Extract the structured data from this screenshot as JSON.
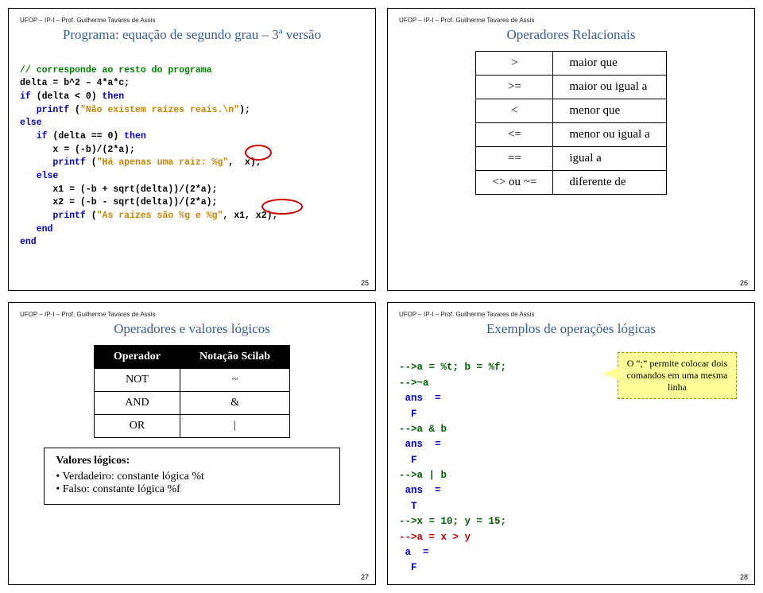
{
  "header": "UFOP – IP-I – Prof. Guilherme Tavares de Assis",
  "pages": [
    "25",
    "26",
    "27",
    "28"
  ],
  "s1": {
    "title": "Programa: equação de segundo grau – 3ª versão",
    "code_comment": "// corresponde ao resto do programa",
    "l2_a": "delta = b^2 – 4*a*c;",
    "l3_if": "if",
    "l3_b": " (delta < 0) ",
    "l3_then": "then",
    "l4_p": "printf",
    "l4_a": " (",
    "l4_s": "\"Não existem raízes reais.\\n\"",
    "l4_b": ");",
    "l5_else": "else",
    "l6_if": "if",
    "l6_b": " (delta == 0) ",
    "l6_then": "then",
    "l7_a": "      x = (-b)/(2*a);",
    "l8_p": "printf",
    "l8_a": " (",
    "l8_s": "\"Há apenas uma raiz: %g\"",
    "l8_b": ",  x);",
    "l9_else": "else",
    "l10": "      x1 = (-b + sqrt(delta))/(2*a);",
    "l11": "      x2 = (-b - sqrt(delta))/(2*a);",
    "l12_p": "printf",
    "l12_a": " (",
    "l12_s": "\"As raizes são %g e %g\"",
    "l12_b": ", x1, x2);",
    "l13_end": "end",
    "l14_end": "end"
  },
  "s2": {
    "title": "Operadores Relacionais",
    "rows": [
      {
        "op": ">",
        "desc": "maior que"
      },
      {
        "op": ">=",
        "desc": "maior ou igual a"
      },
      {
        "op": "<",
        "desc": "menor que"
      },
      {
        "op": "<=",
        "desc": "menor ou igual a"
      },
      {
        "op": "==",
        "desc": "igual a"
      },
      {
        "op": "<> ou ~=",
        "desc": "diferente de"
      }
    ]
  },
  "s3": {
    "title": "Operadores e valores lógicos",
    "hdr_l": "Operador",
    "hdr_r": "Notação Scilab",
    "rows": [
      {
        "l": "NOT",
        "r": "~"
      },
      {
        "l": "AND",
        "r": "&"
      },
      {
        "l": "OR",
        "r": "|"
      }
    ],
    "val_head": "Valores lógicos:",
    "val1": "Verdadeiro: constante lógica %t",
    "val2": "Falso: constante lógica %f"
  },
  "s4": {
    "title": "Exemplos de operações lógicas",
    "l1": "-->a = %t; b = %f;",
    "l2": "-->~a",
    "l3a": " ans  =",
    "l3b": "  F",
    "l4": "-->a & b",
    "l5a": " ans  =",
    "l5b": "  F",
    "l6": "-->a | b",
    "l7a": " ans  =",
    "l7b": "  T",
    "l8": "-->x = 10; y = 15;",
    "l9": "-->a = x > y",
    "l10a": " a  =",
    "l10b": "  F",
    "callout": "O “;” permite colocar dois comandos em uma mesma linha"
  }
}
